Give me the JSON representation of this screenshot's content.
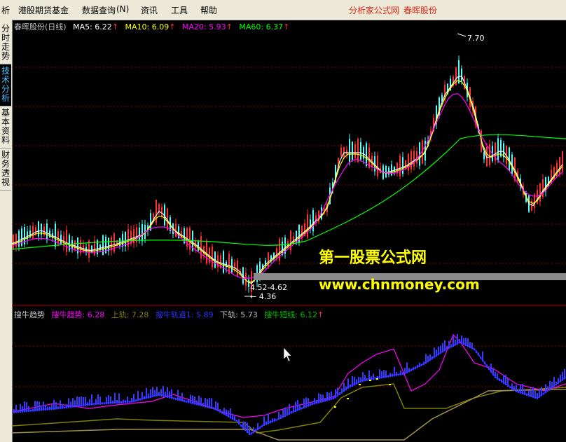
{
  "menu": {
    "items": [
      "析",
      "港股期货基金",
      "数据查询",
      "(N)",
      "资讯",
      "工具",
      "帮助"
    ],
    "right_site": "分析家公式网",
    "right_stock": "春晖股份"
  },
  "sidebar": {
    "tabs": [
      "分时走势",
      "技术分析",
      "基本资料",
      "财务透视"
    ]
  },
  "main_panel": {
    "title": "春晖股份(日线)",
    "ma5": "MA5: 6.22",
    "ma10": "MA10: 6.09",
    "ma20": "MA20: 5.93",
    "ma60": "MA60: 6.37",
    "arrow": "↑",
    "high_label": "7.70",
    "low_label": "4.36",
    "range_label": "4.52-4.62",
    "colors": {
      "ma5": "#ffffff",
      "ma10": "#ffff00",
      "ma20": "#ff00ff",
      "ma60": "#00ff00",
      "up": "#ff3232",
      "down": "#54fcfc",
      "grid": "#8b0000"
    }
  },
  "indicator_panel": {
    "name": "搜牛趋势",
    "line1": "搜牛趋势: 6.28",
    "line2": "上轨: 7.28",
    "line3": "搜牛轨道1: 5.89",
    "line4": "下轨: 5.73",
    "line5": "搜牛短线: 6.12",
    "arrow": "↑"
  },
  "watermark": {
    "line1": "第一股票公式网",
    "line2": "www.chnmoney.com"
  }
}
